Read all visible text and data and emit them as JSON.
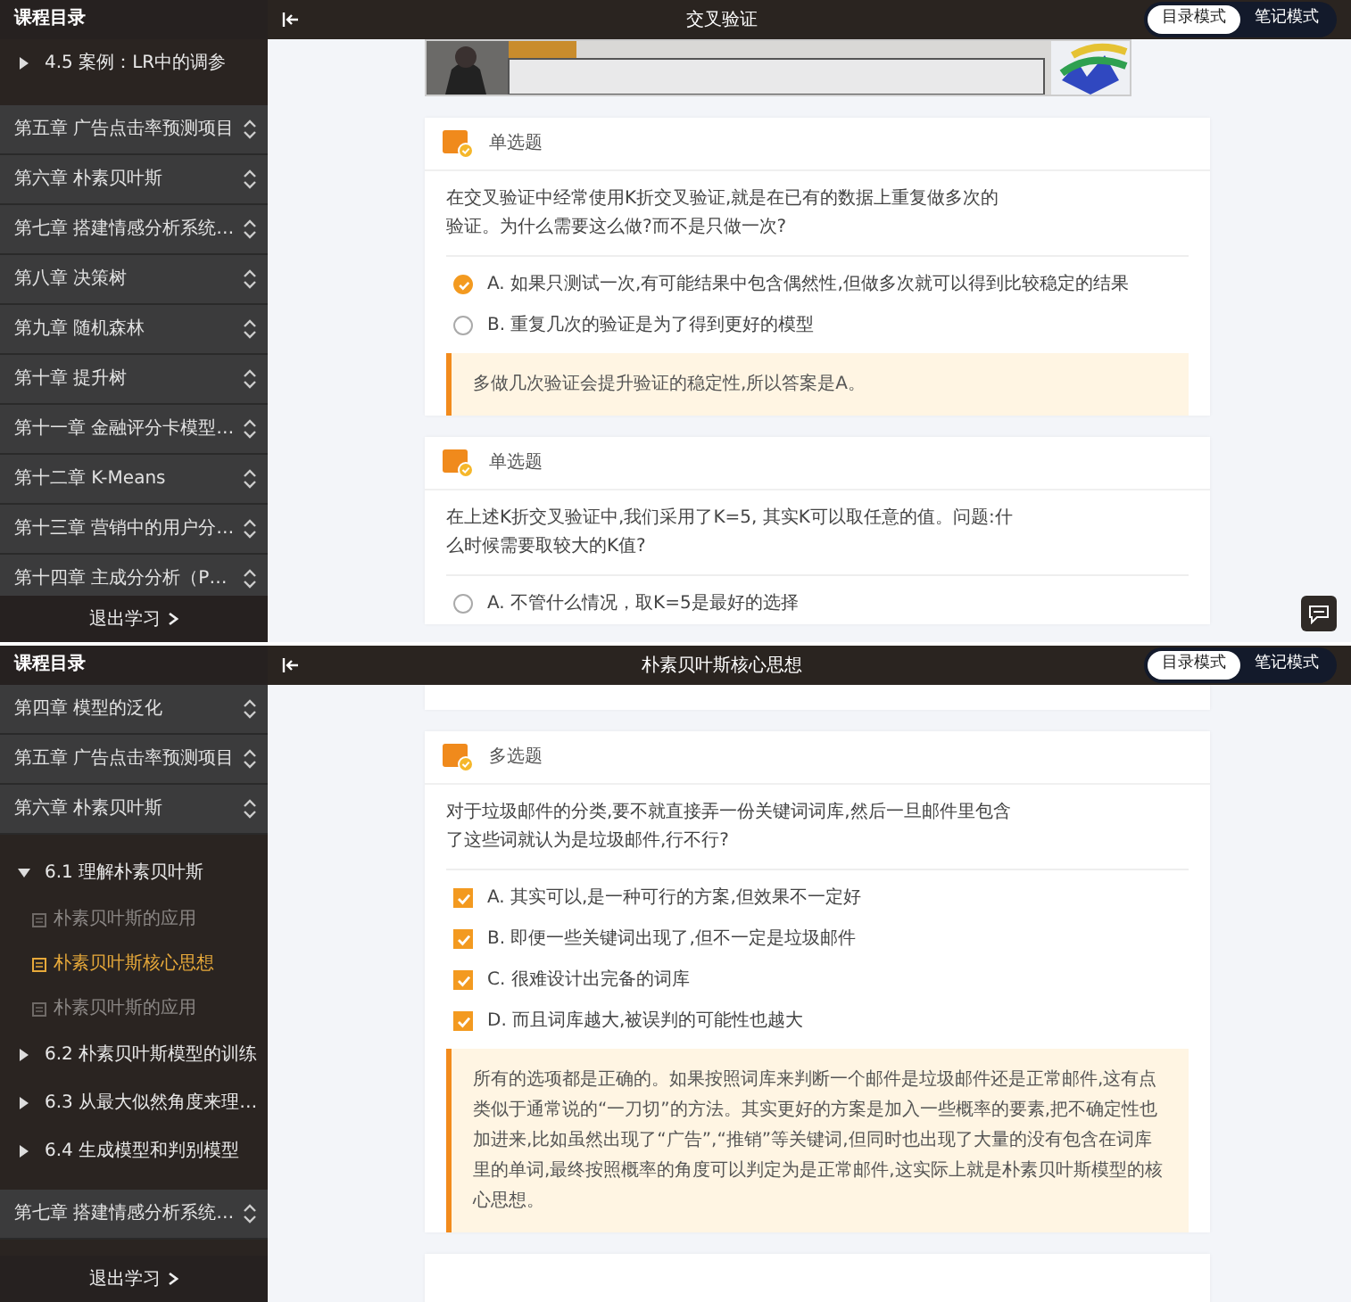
{
  "screens": [
    {
      "sidebar": {
        "title": "课程目录",
        "items": [
          {
            "kind": "section",
            "label": "4.5 案例：LR中的调参",
            "expanded": false
          },
          {
            "kind": "chapter",
            "label": "第五章 广告点击率预测项目"
          },
          {
            "kind": "chapter",
            "label": "第六章 朴素贝叶斯"
          },
          {
            "kind": "chapter",
            "label": "第七章 搭建情感分析系统…"
          },
          {
            "kind": "chapter",
            "label": "第八章 决策树"
          },
          {
            "kind": "chapter",
            "label": "第九章 随机森林"
          },
          {
            "kind": "chapter",
            "label": "第十章 提升树"
          },
          {
            "kind": "chapter",
            "label": "第十一章 金融评分卡模型…"
          },
          {
            "kind": "chapter",
            "label": "第十二章 K-Means"
          },
          {
            "kind": "chapter",
            "label": "第十三章 营销中的用户分…"
          },
          {
            "kind": "chapter",
            "label": "第十四章 主成分分析（P…"
          }
        ],
        "exit": "退出学习"
      },
      "header": {
        "title": "交叉验证",
        "modes": [
          {
            "label": "目录模式",
            "selected": true
          },
          {
            "label": "笔记模式",
            "selected": false
          }
        ]
      },
      "content": [
        {
          "kind": "picture"
        },
        {
          "kind": "question",
          "type": "单选题",
          "text": "在交叉验证中经常使用K折交叉验证,就是在已有的数据上重复做多次的验证。为什么需要这么做?而不是只做一次?",
          "options": [
            {
              "kind": "radio",
              "label": "A. 如果只测试一次,有可能结果中包含偶然性,但做多次就可以得到比较稳定的结果",
              "checked": true
            },
            {
              "kind": "radio",
              "label": "B. 重复几次的验证是为了得到更好的模型",
              "checked": false
            }
          ],
          "explanation": "多做几次验证会提升验证的稳定性,所以答案是A。"
        },
        {
          "kind": "question",
          "type": "单选题",
          "text": "在上述K折交叉验证中,我们采用了K=5, 其实K可以取任意的值。问题:什么时候需要取较大的K值?",
          "options": [
            {
              "kind": "radio",
              "label": "A. 不管什么情况，取K=5是最好的选择",
              "checked": false
            }
          ]
        }
      ],
      "chat_button": true
    },
    {
      "sidebar": {
        "title": "课程目录",
        "items": [
          {
            "kind": "chapter",
            "label": "第四章 模型的泛化"
          },
          {
            "kind": "chapter",
            "label": "第五章 广告点击率预测项目"
          },
          {
            "kind": "chapter",
            "label": "第六章 朴素贝叶斯",
            "children": [
              {
                "kind": "section",
                "label": "6.1 理解朴素贝叶斯",
                "expanded": true,
                "children": [
                  {
                    "kind": "lesson",
                    "label": "朴素贝叶斯的应用",
                    "selected": false
                  },
                  {
                    "kind": "lesson",
                    "label": "朴素贝叶斯核心思想",
                    "selected": true
                  },
                  {
                    "kind": "lesson",
                    "label": "朴素贝叶斯的应用",
                    "selected": false
                  }
                ]
              },
              {
                "kind": "section",
                "label": "6.2 朴素贝叶斯模型的训练",
                "expanded": false
              },
              {
                "kind": "section",
                "label": "6.3 从最大似然角度来理…",
                "expanded": false
              },
              {
                "kind": "section",
                "label": "6.4 生成模型和判别模型",
                "expanded": false
              }
            ]
          },
          {
            "kind": "chapter",
            "label": "第七章 搭建情感分析系统…"
          }
        ],
        "exit": "退出学习"
      },
      "header": {
        "title": "朴素贝叶斯核心思想",
        "modes": [
          {
            "label": "目录模式",
            "selected": true
          },
          {
            "label": "笔记模式",
            "selected": false
          }
        ]
      },
      "content": [
        {
          "kind": "card_end"
        },
        {
          "kind": "question",
          "type": "多选题",
          "text": "对于垃圾邮件的分类,要不就直接弄一份关键词词库,然后一旦邮件里包含了这些词就认为是垃圾邮件,行不行?",
          "options": [
            {
              "kind": "checkbox",
              "label": "A. 其实可以,是一种可行的方案,但效果不一定好",
              "checked": true
            },
            {
              "kind": "checkbox",
              "label": "B. 即便一些关键词出现了,但不一定是垃圾邮件",
              "checked": true
            },
            {
              "kind": "checkbox",
              "label": "C. 很难设计出完备的词库",
              "checked": true
            },
            {
              "kind": "checkbox",
              "label": "D. 而且词库越大,被误判的可能性也越大",
              "checked": true
            }
          ],
          "explanation": "所有的选项都是正确的。如果按照词库来判断一个邮件是垃圾邮件还是正常邮件,这有点类似于通常说的“一刀切”的方法。其实更好的方案是加入一些概率的要素,把不确定性也加进来,比如虽然出现了“广告”,“推销”等关键词,但同时也出现了大量的没有包含在词库里的单词,最终按照概率的角度可以判定为是正常邮件,这实际上就是朴素贝叶斯模型的核心思想。"
        },
        {
          "kind": "card_start"
        }
      ]
    }
  ]
}
